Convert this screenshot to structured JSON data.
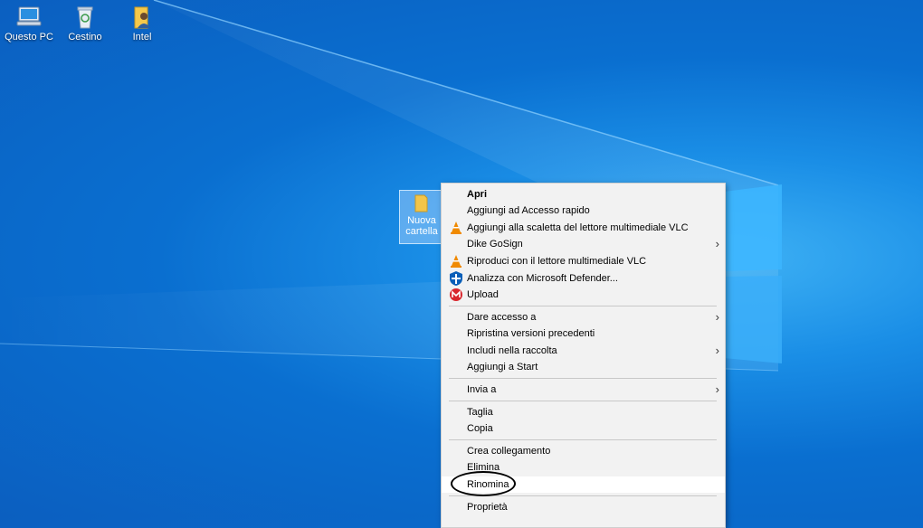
{
  "desktop": {
    "icons": [
      {
        "label": "Questo PC",
        "icon": "this-pc-icon"
      },
      {
        "label": "Cestino",
        "icon": "recycle-bin-icon"
      },
      {
        "label": "Intel",
        "icon": "user-folder-icon"
      }
    ],
    "selected_folder": {
      "label_line1": "Nuova",
      "label_line2": "cartella",
      "icon": "folder-icon"
    }
  },
  "context_menu": {
    "items": [
      {
        "label": "Apri",
        "bold": true
      },
      {
        "label": "Aggiungi ad Accesso rapido"
      },
      {
        "label": "Aggiungi alla scaletta del lettore multimediale VLC",
        "icon": "vlc-icon"
      },
      {
        "label": "Dike GoSign",
        "submenu": true
      },
      {
        "label": "Riproduci con il lettore multimediale VLC",
        "icon": "vlc-icon"
      },
      {
        "label": "Analizza con Microsoft Defender...",
        "icon": "defender-icon"
      },
      {
        "label": "Upload",
        "icon": "mega-icon"
      },
      {
        "label": "Dare accesso a",
        "submenu": true
      },
      {
        "label": "Ripristina versioni precedenti"
      },
      {
        "label": "Includi nella raccolta",
        "submenu": true
      },
      {
        "label": "Aggiungi a Start"
      },
      {
        "label": "Invia a",
        "submenu": true
      },
      {
        "label": "Taglia"
      },
      {
        "label": "Copia"
      },
      {
        "label": "Crea collegamento"
      },
      {
        "label": "Elimina"
      },
      {
        "label": "Rinomina",
        "highlighted": true
      },
      {
        "label": "Proprietà"
      }
    ],
    "submenu_glyph": "›"
  },
  "colors": {
    "desktop_blue": "#0a6fd0",
    "menu_bg": "#f2f2f2",
    "vlc_orange": "#f08a00",
    "defender_blue": "#0a5fb8",
    "mega_red": "#d9272e"
  }
}
